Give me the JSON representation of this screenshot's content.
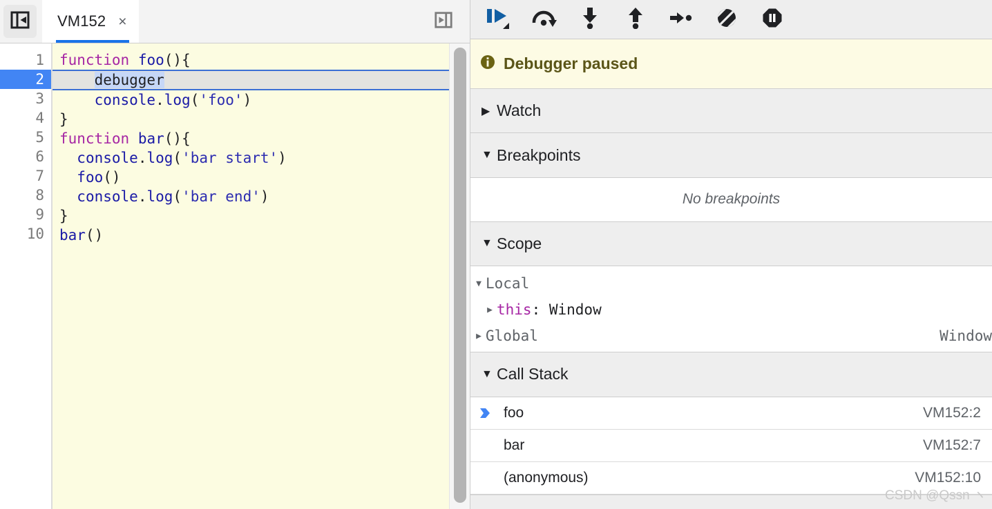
{
  "editor": {
    "nav_toggle_icon": "show-navigator-icon",
    "overflow_icon": "show-debugger-icon",
    "tabs": [
      {
        "label": "VM152",
        "close_label": "×",
        "active": true
      }
    ],
    "gutter": [
      "1",
      "2",
      "3",
      "4",
      "5",
      "6",
      "7",
      "8",
      "9",
      "10"
    ],
    "paused_line": 2,
    "code_lines": [
      "function foo(){",
      "    debugger",
      "    console.log('foo')",
      "}",
      "function bar(){",
      "  console.log('bar start')",
      "  foo()",
      "  console.log('bar end')",
      "}",
      "bar()"
    ],
    "selected_token": "debugger"
  },
  "debugger": {
    "toolbar": [
      {
        "name": "resume-script-execution",
        "icon": "resume-icon"
      },
      {
        "name": "step-over-next-function-call",
        "icon": "step-over-icon"
      },
      {
        "name": "step-into-next-function-call",
        "icon": "step-into-icon"
      },
      {
        "name": "step-out-of-current-function",
        "icon": "step-out-icon"
      },
      {
        "name": "step",
        "icon": "step-icon"
      },
      {
        "name": "deactivate-breakpoints",
        "icon": "deactivate-breakpoints-icon"
      },
      {
        "name": "pause-on-exceptions",
        "icon": "pause-on-exceptions-icon"
      }
    ],
    "banner": {
      "icon": "info-icon",
      "text": "Debugger paused"
    },
    "watch": {
      "title": "Watch",
      "caret": "▶",
      "expanded": false
    },
    "breakpoints": {
      "title": "Breakpoints",
      "caret": "▼",
      "expanded": true,
      "empty_text": "No breakpoints"
    },
    "scope": {
      "title": "Scope",
      "caret": "▼",
      "expanded": true,
      "rows": [
        {
          "caret": "▼",
          "name": "Local",
          "indent": 1,
          "kind": "scope-name",
          "value": "",
          "right": ""
        },
        {
          "caret": "▶",
          "name": "this",
          "indent": 2,
          "kind": "scope-this",
          "value": ": Window",
          "right": ""
        },
        {
          "caret": "▶",
          "name": "Global",
          "indent": 1,
          "kind": "scope-name",
          "value": "",
          "right": "Window"
        }
      ]
    },
    "call_stack": {
      "title": "Call Stack",
      "caret": "▼",
      "expanded": true,
      "frames": [
        {
          "name": "foo",
          "location": "VM152:2",
          "active": true
        },
        {
          "name": "bar",
          "location": "VM152:7",
          "active": false
        },
        {
          "name": "(anonymous)",
          "location": "VM152:10",
          "active": false
        }
      ]
    }
  },
  "watermark": "CSDN @Qssn ヽ",
  "colors": {
    "accent_blue": "#1a73e8",
    "paused_gutter": "#4285f4",
    "code_bg": "#fcfce1",
    "banner_bg": "#fdfbe4",
    "banner_text": "#5b5518",
    "section_bg": "#eeeeee"
  }
}
